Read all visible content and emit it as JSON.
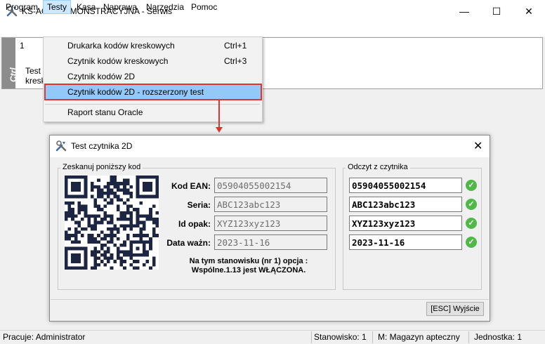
{
  "window": {
    "title": "KS-AOW DEMONSTRACYJNA - Serwis",
    "minimize": "—",
    "maximize": "☐",
    "close": "✕"
  },
  "menubar": {
    "items": [
      "Program",
      "Testy",
      "Kasa",
      "Naprawa",
      "Narzędzia",
      "Pomoc"
    ],
    "active": "Testy"
  },
  "panel": {
    "side_label": "Ctrl",
    "number": "1",
    "text_line1": "Test",
    "text_line2": "kresk"
  },
  "dropdown": {
    "items": [
      {
        "label": "Drukarka kodów kreskowych",
        "shortcut": "Ctrl+1"
      },
      {
        "label": "Czytnik kodów kreskowych",
        "shortcut": "Ctrl+3"
      },
      {
        "label": "Czytnik kodów 2D",
        "shortcut": ""
      },
      {
        "label": "Czytnik kodów 2D - rozszerzony test",
        "shortcut": ""
      },
      {
        "label": "Raport stanu Oracle",
        "shortcut": ""
      }
    ],
    "highlighted_index": 3
  },
  "dialog": {
    "title": "Test czytnika 2D",
    "close": "✕",
    "left_group_label": "Zeskanuj poniższy kod",
    "right_group_label": "Odczyt z czytnika",
    "fields": [
      {
        "label": "Kod EAN:",
        "value": "05904055002154"
      },
      {
        "label": "Seria:",
        "value": "ABC123abc123"
      },
      {
        "label": "Id opak:",
        "value": "XYZ123xyz123"
      },
      {
        "label": "Data ważn:",
        "value": "2023-11-16"
      }
    ],
    "readings": [
      {
        "value": "05904055002154",
        "status": "ok"
      },
      {
        "value": "ABC123abc123",
        "status": "ok"
      },
      {
        "value": "XYZ123xyz123",
        "status": "ok"
      },
      {
        "value": "2023-11-16",
        "status": "ok"
      }
    ],
    "check_glyph": "✓",
    "notice_line1": "Na tym stanowisku (nr 1) opcja :",
    "notice_line2": "Wspólne.1.13 jest WŁĄCZONA.",
    "exit_button": "[ESC] Wyjście"
  },
  "statusbar": {
    "user": "Pracuje: Administrator",
    "station": "Stanowisko: 1",
    "warehouse": "M: Magazyn apteczny",
    "unit": "Jednostka: 1"
  },
  "colors": {
    "highlight": "#91c9f7",
    "annotation_red": "#e03434",
    "check_green": "#4fb847",
    "qr_dark": "#1c2541"
  }
}
